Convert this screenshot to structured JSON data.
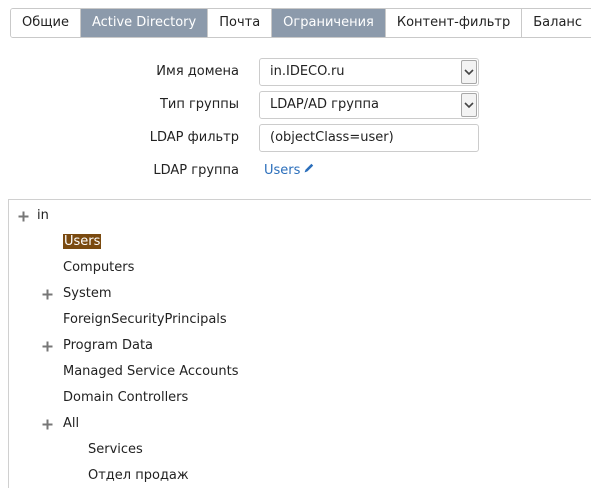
{
  "tabs": [
    {
      "label": "Общие",
      "active": false
    },
    {
      "label": "Active Directory",
      "active": true
    },
    {
      "label": "Почта",
      "active": false
    },
    {
      "label": "Ограничения",
      "active": true
    },
    {
      "label": "Контент-фильтр",
      "active": false
    },
    {
      "label": "Баланс",
      "active": false
    }
  ],
  "form": {
    "domain_label": "Имя домена",
    "domain_value": "in.IDECO.ru",
    "group_type_label": "Тип группы",
    "group_type_value": "LDAP/AD группа",
    "ldap_filter_label": "LDAP фильтр",
    "ldap_filter_value": "(objectClass=user)",
    "ldap_group_label": "LDAP группа",
    "ldap_group_value": "Users"
  },
  "tree": {
    "nodes": [
      {
        "label": "in",
        "expandable": true,
        "selected": false
      },
      {
        "label": "Users",
        "expandable": false,
        "selected": true
      },
      {
        "label": "Computers",
        "expandable": false,
        "selected": false
      },
      {
        "label": "System",
        "expandable": true,
        "selected": false
      },
      {
        "label": "ForeignSecurityPrincipals",
        "expandable": false,
        "selected": false
      },
      {
        "label": "Program Data",
        "expandable": true,
        "selected": false
      },
      {
        "label": "Managed Service Accounts",
        "expandable": false,
        "selected": false
      },
      {
        "label": "Domain Controllers",
        "expandable": false,
        "selected": false
      },
      {
        "label": "All",
        "expandable": true,
        "selected": false
      },
      {
        "label": "Services",
        "expandable": false,
        "selected": false
      },
      {
        "label": "Отдел продаж",
        "expandable": false,
        "selected": false
      }
    ]
  },
  "icons": {
    "expand": "plus-icon",
    "dropdown": "chevron-down-icon",
    "edit": "pencil-icon"
  },
  "colors": {
    "active_tab": "#8c9aab",
    "link": "#2a6ebb",
    "selected_node": "#7a4a10"
  }
}
